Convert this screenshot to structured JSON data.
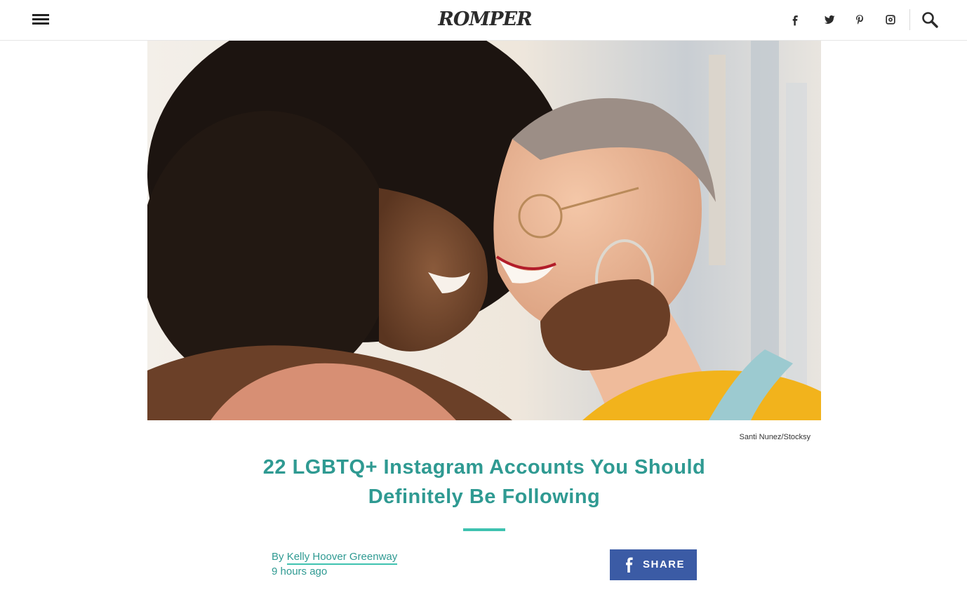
{
  "header": {
    "logo": "ROMPER",
    "menu_icon": "hamburger-menu-icon",
    "social": [
      {
        "name": "facebook-icon"
      },
      {
        "name": "twitter-icon"
      },
      {
        "name": "pinterest-icon"
      },
      {
        "name": "instagram-icon"
      }
    ],
    "search_icon": "search-icon"
  },
  "hero": {
    "credit": "Santi Nunez/Stocksy"
  },
  "article": {
    "headline": "22 LGBTQ+ Instagram Accounts You Should Definitely Be Following",
    "by_prefix": "By",
    "author": "Kelly Hoover Greenway",
    "published": "9 hours ago"
  },
  "share": {
    "label": "SHARE",
    "icon": "facebook-icon"
  },
  "colors": {
    "accent": "#2f9a92",
    "rule": "#3ec2b0",
    "share_bg": "#3b5ba5"
  }
}
